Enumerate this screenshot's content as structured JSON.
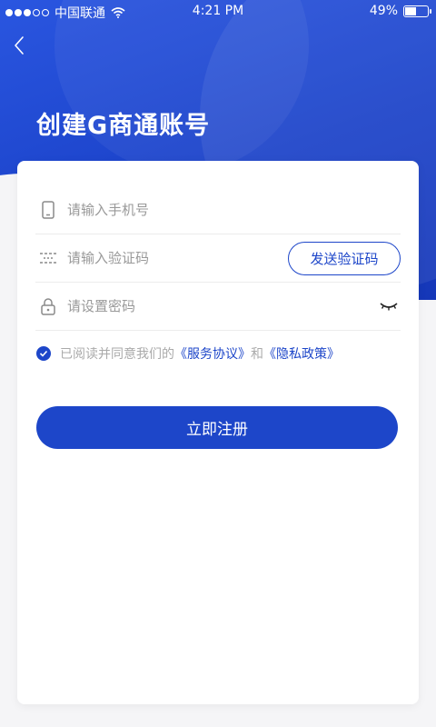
{
  "status_bar": {
    "carrier": "中国联通",
    "time": "4:21 PM",
    "battery": "49%",
    "battery_level": 0.49
  },
  "header": {
    "back_icon": "chevron-left-icon",
    "title": "创建G商通账号"
  },
  "form": {
    "phone": {
      "icon": "phone-icon",
      "placeholder": "请输入手机号",
      "value": ""
    },
    "code": {
      "icon": "sms-code-icon",
      "placeholder": "请输入验证码",
      "value": "",
      "send_label": "发送验证码"
    },
    "password": {
      "icon": "lock-icon",
      "placeholder": "请设置密码",
      "value": "",
      "toggle_icon": "eye-closed-icon"
    },
    "agreement": {
      "checked": true,
      "prefix": "已阅读并同意我们的",
      "service_link": "《服务协议》",
      "connector": "和",
      "privacy_link": "《隐私政策》"
    },
    "submit_label": "立即注册"
  },
  "colors": {
    "accent": "#1d46c9",
    "hero": "#2a56e0",
    "background": "#f5f5f7"
  }
}
